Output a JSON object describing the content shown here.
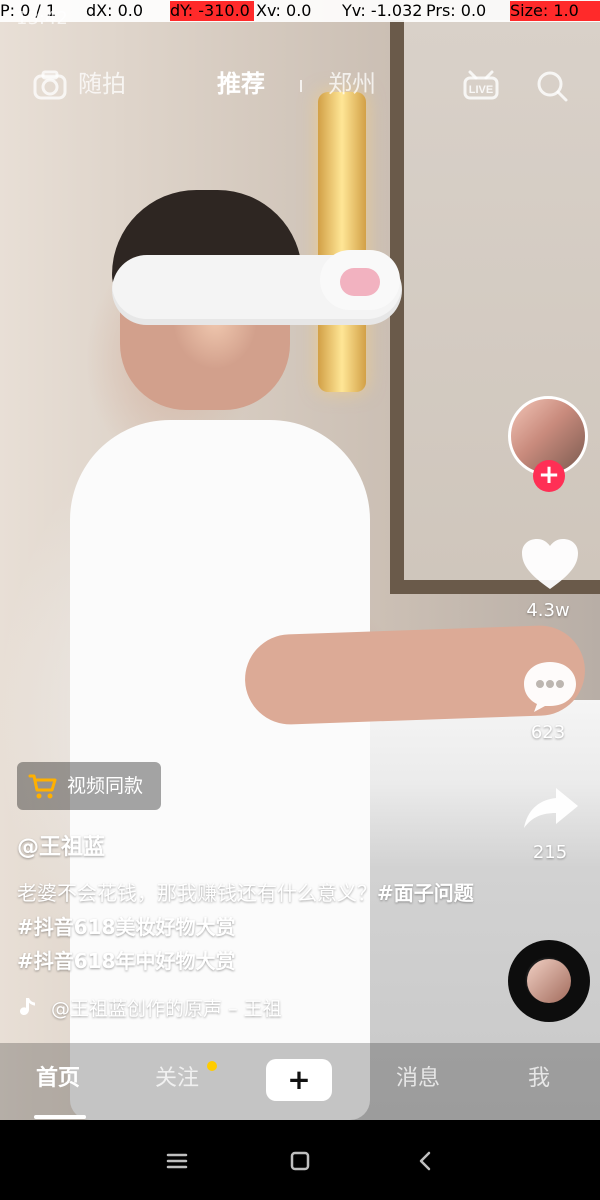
{
  "hud": {
    "p": "P: 0 / 1",
    "dx": "dX: 0.0",
    "dy": "dY: -310.0",
    "xv": "Xv: 0.0",
    "yv": "Yv: -1.032",
    "prs": "Prs: 0.0",
    "size": "Size: 1.0"
  },
  "status": {
    "time": "13:42"
  },
  "topnav": {
    "camera_label": "随拍",
    "tab_recommend": "推荐",
    "tab_local": "郑州",
    "live_icon": "live-icon",
    "search_icon": "search-icon"
  },
  "shop": {
    "label": "视频同款"
  },
  "post": {
    "username": "@王祖蓝",
    "desc_plain_1": "老婆不会花钱，那我赚钱还有什么意义？",
    "tags_1": [
      "#面子问题",
      "#抖音618美妆好物大赏"
    ],
    "tags_2": [
      "#抖音618年中好物大赏"
    ]
  },
  "sound": {
    "text": "@王祖蓝创作的原声 – 王祖"
  },
  "actions": {
    "likes": "4.3w",
    "comments": "623",
    "shares": "215"
  },
  "tabbar": {
    "home": "首页",
    "follow": "关注",
    "create": "+",
    "messages": "消息",
    "me": "我"
  },
  "colors": {
    "accent_red": "#ff2f55",
    "accent_cyan": "#27f2ff",
    "notification_dot": "#ffcc00"
  }
}
